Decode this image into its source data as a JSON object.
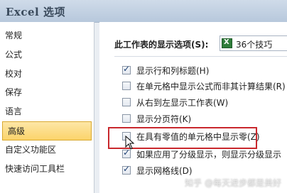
{
  "window": {
    "title": "Excel 选项"
  },
  "sidebar": {
    "items": [
      {
        "label": "常规",
        "selected": false
      },
      {
        "label": "公式",
        "selected": false
      },
      {
        "label": "校对",
        "selected": false
      },
      {
        "label": "保存",
        "selected": false
      },
      {
        "label": "语言",
        "selected": false
      },
      {
        "label": "高级",
        "selected": true
      },
      {
        "label": "自定义功能区",
        "selected": false
      },
      {
        "label": "快速访问工具栏",
        "selected": false
      }
    ]
  },
  "main": {
    "section_label": "此工作表的显示选项(S):",
    "sheet_select": "36个技巧",
    "options": [
      {
        "label": "显示行和列标题(H)",
        "checked": true
      },
      {
        "label": "在单元格中显示公式而非其计算结果(R)",
        "checked": false
      },
      {
        "label": "从右到左显示工作表(W)",
        "checked": false
      },
      {
        "label": "显示分页符(K)",
        "checked": false
      },
      {
        "label": "在具有零值的单元格中显示零(Z)",
        "checked": false
      },
      {
        "label": "如果应用了分级显示，则显示分级显示",
        "checked": true
      },
      {
        "label": "显示网格线(D)",
        "checked": true
      }
    ]
  },
  "watermark": "知乎 @每天进步都是美好",
  "colors": {
    "highlight": "#c9282d",
    "selected_nav": "#fbd46b"
  }
}
